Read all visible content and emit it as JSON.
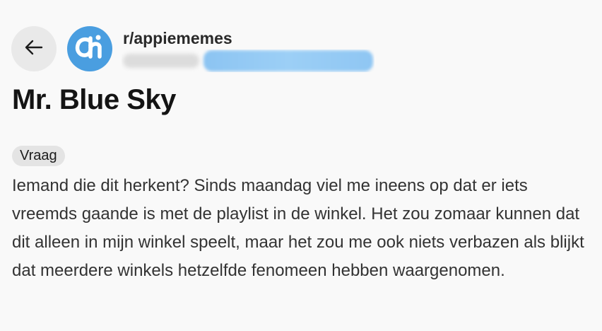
{
  "header": {
    "back_icon": "arrow-left-icon",
    "subreddit_avatar_icon": "albert-heijn-logo",
    "subreddit_name": "r/appiememes"
  },
  "post": {
    "title": "Mr. Blue Sky",
    "flair": "Vraag",
    "body": "Iemand die dit herkent? Sinds maandag viel me ineens op dat er iets vreemds gaande is met de playlist in de winkel. Het zou zomaar kunnen dat dit alleen in mijn winkel speelt, maar het zou me ook niets verbazen als blijkt dat meerdere winkels hetzelfde fenomeen hebben waargenomen."
  },
  "colors": {
    "background": "#f9f9f9",
    "avatar": "#4a9ee0",
    "flair_bg": "#e4e4e4",
    "back_button_bg": "#e9e9e9"
  }
}
